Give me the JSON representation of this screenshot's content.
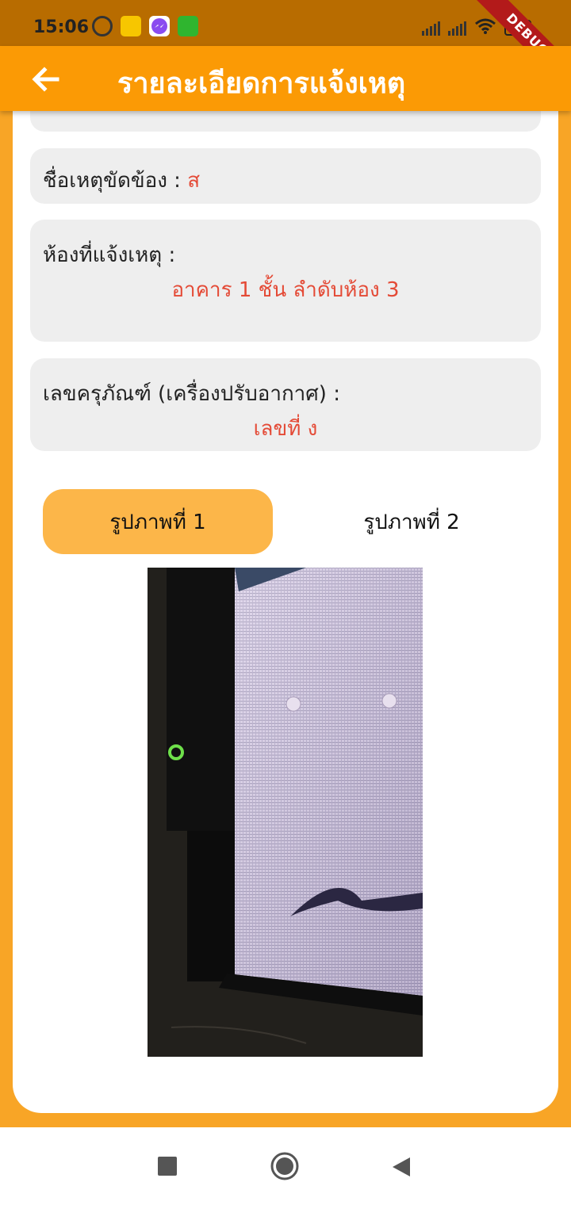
{
  "status_bar": {
    "time": "15:06",
    "debug_label": "DEBUG"
  },
  "app_bar": {
    "title": "รายละเอียดการแจ้งเหตุ",
    "back_icon": "arrow-left-icon"
  },
  "details": {
    "fault_name_label": "ชื่อเหตุขัดข้อง :",
    "fault_name_value": "ส",
    "room_label": "ห้องที่แจ้งเหตุ :",
    "room_value": "อาคาร 1 ชั้น  ลำดับห้อง 3",
    "equipment_label": "เลขครุภัณฑ์ (เครื่องปรับอากาศ) :",
    "equipment_value": "เลขที่ ง"
  },
  "tabs": [
    {
      "label": "รูปภาพที่ 1",
      "active": true
    },
    {
      "label": "รูปภาพที่ 2",
      "active": false
    }
  ],
  "colors": {
    "primary": "#fb9a05",
    "accent_tab": "#fcb649",
    "value_text": "#e44a36"
  }
}
